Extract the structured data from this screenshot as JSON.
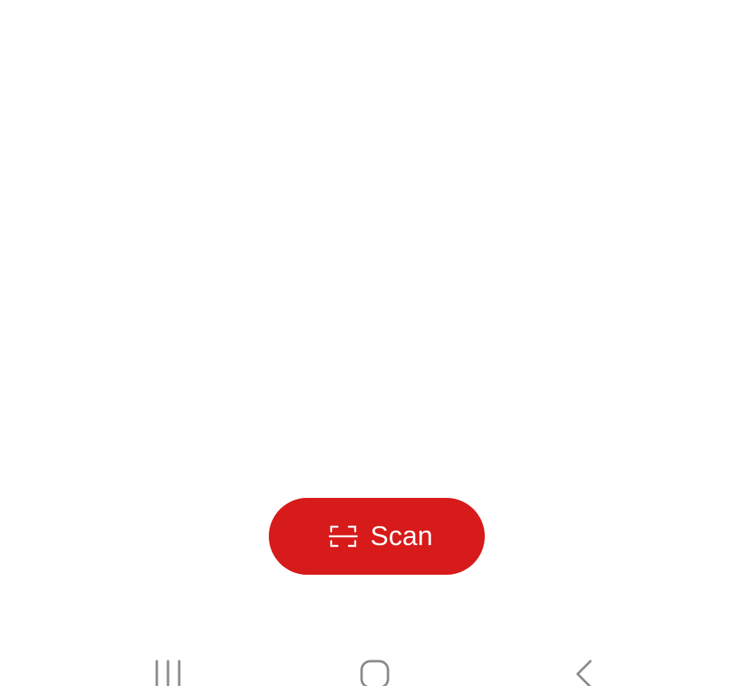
{
  "scan_button": {
    "label": "Scan",
    "icon": "scan-frame-icon",
    "background_color": "#d71a1a",
    "text_color": "#ffffff"
  },
  "navigation_bar": {
    "recents_icon": "recents-icon",
    "home_icon": "home-icon",
    "back_icon": "back-icon",
    "icon_color": "#8a8a8a"
  }
}
